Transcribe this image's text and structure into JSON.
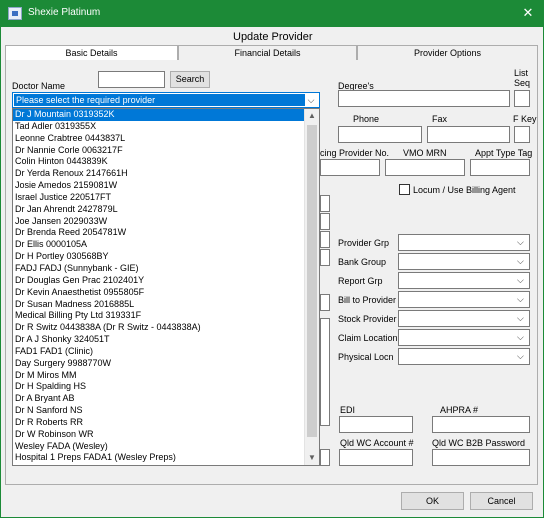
{
  "window": {
    "app_title": "Shexie Platinum",
    "close_glyph": "✕"
  },
  "dialog": {
    "heading": "Update Provider"
  },
  "tabs": [
    {
      "label": "Basic Details"
    },
    {
      "label": "Financial Details"
    },
    {
      "label": "Provider Options"
    }
  ],
  "doctor": {
    "label": "Doctor Name",
    "search_value": "",
    "search_button": "Search",
    "combo_value": "Please select the required provider",
    "options": [
      "Dr J Mountain  0319352K",
      "Tad Adler  0319355X",
      "Leonne Crabtree  0443837L",
      "Dr Nannie Corle  0063217F",
      "Colin Hinton  0443839K",
      "Dr Yerda Renoux  2147661H",
      "Josie Amedos  2159081W",
      "Israel Justice  220517FT",
      "Dr Jan Ahrendt  2427879L",
      "Joe Jansen  2029033W",
      "Dr Brenda Reed  2054781W",
      "Dr Ellis  0000105A",
      "Dr H Portley  030568BY",
      "FADJ  FADJ (Sunnybank - GIE)",
      "Dr Douglas Gen Prac  2102401Y",
      "Dr Kevin Anaesthetist  0955805F",
      "Dr Susan Madness  2016885L",
      "Medical Billing Pty Ltd  319331F",
      "Dr R Switz  0443838A (Dr R Switz - 0443838A)",
      "Dr A J Shonky  324051T",
      "FAD1  FAD1     (Clinic)",
      "Day Surgery  9988770W",
      "Dr  M Miros    MM",
      "Dr H Spalding   HS",
      "Dr A Bryant   AB",
      "Dr N Sanford   NS",
      "Dr R Roberts   RR",
      "Dr W Robinson   WR",
      "Wesley   FADA (Wesley)",
      "Hospital 1 Preps   FADA1 (Wesley Preps)"
    ],
    "selected_index": 0
  },
  "right": {
    "degrees_label": "Degree's",
    "list_seq_label": "List\nSeq",
    "phone_label": "Phone",
    "fax_label": "Fax",
    "fkey_label": "F Key",
    "billing_provider_label": "cing Provider No.",
    "vmo_label": "VMO MRN",
    "appt_type_label": "Appt Type Tag",
    "locum_label": "Locum / Use Billing Agent",
    "provider_grp_label": "Provider Grp",
    "bank_group_label": "Bank Group",
    "report_grp_label": "Report Grp",
    "bill_to_label": "Bill to Provider",
    "stock_provider_label": "Stock Provider",
    "claim_location_label": "Claim Location",
    "physical_locn_label": "Physical Locn",
    "edi_label": "EDI",
    "ahpra_label": "AHPRA #",
    "qld_wc_account_label": "Qld WC Account #",
    "qld_wc_b2b_label": "Qld WC B2B Password"
  },
  "footer": {
    "ok": "OK",
    "cancel": "Cancel"
  },
  "icons": {
    "chevron": "chevron-down-icon"
  }
}
